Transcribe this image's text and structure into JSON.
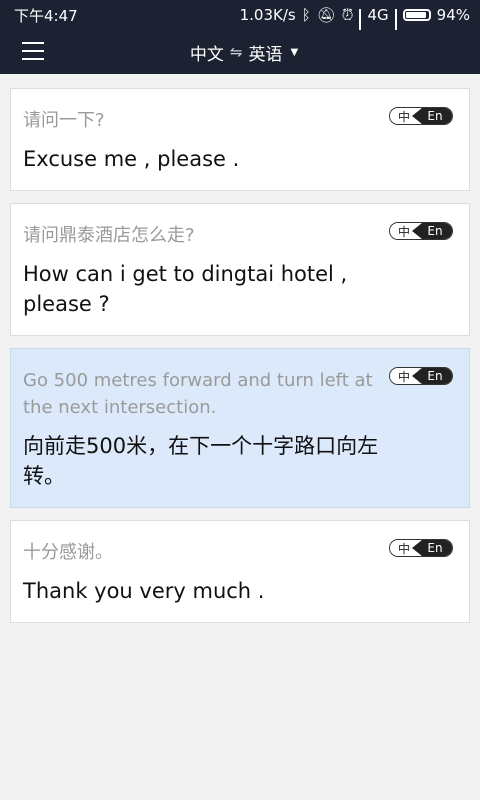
{
  "status_bar": {
    "time": "下午4:47",
    "net_speed": "1.03K/s",
    "network_type": "4G",
    "battery": "94%",
    "battery_level": 0.94,
    "icons": [
      "bluetooth-icon",
      "mute-icon",
      "alarm-icon",
      "signal-icon",
      "battery-icon"
    ]
  },
  "app_bar": {
    "source_lang": "中文",
    "target_lang": "英语",
    "swap_symbol": "⇋",
    "caret": "▼",
    "menu_icon": "menu-icon"
  },
  "cards": [
    {
      "source": "请问一下?",
      "translation": "Excuse me , please .",
      "toggle_zh": "中",
      "toggle_en": "En",
      "active": false
    },
    {
      "source": "请问鼎泰酒店怎么走?",
      "translation": "How can i get to dingtai hotel , please ?",
      "toggle_zh": "中",
      "toggle_en": "En",
      "active": false
    },
    {
      "source": "Go 500 metres forward and turn left at the next intersection.",
      "translation": "向前走500米，在下一个十字路口向左转。",
      "toggle_zh": "中",
      "toggle_en": "En",
      "active": true
    },
    {
      "source": "十分感谢。",
      "translation": "Thank you very much .",
      "toggle_zh": "中",
      "toggle_en": "En",
      "active": false
    }
  ],
  "colors": {
    "app_bar": "#1c2231",
    "active_card": "#dbe9fb",
    "background": "#f2f2f2"
  }
}
